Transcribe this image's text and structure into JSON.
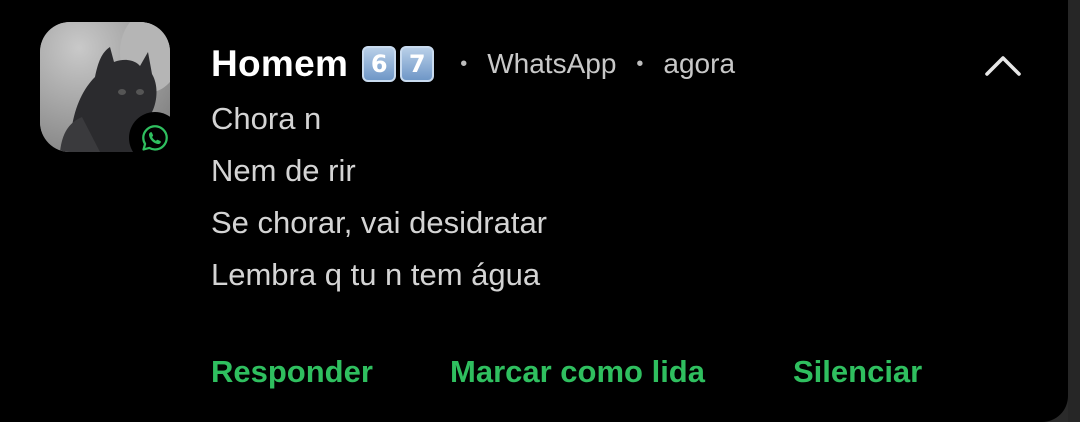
{
  "notification": {
    "sender": "Homem",
    "sender_emoji": [
      "6",
      "7"
    ],
    "app_name": "WhatsApp",
    "time": "agora",
    "separator": "•",
    "app_icon": "whatsapp-icon",
    "collapse_icon": "chevron-up-icon",
    "accent_color": "#2fbf5f"
  },
  "messages": [
    "Chora n",
    "Nem de rir",
    "Se chorar, vai desidratar",
    "Lembra q tu n tem água"
  ],
  "actions": {
    "reply": "Responder",
    "mark_read": "Marcar como lida",
    "mute": "Silenciar"
  }
}
